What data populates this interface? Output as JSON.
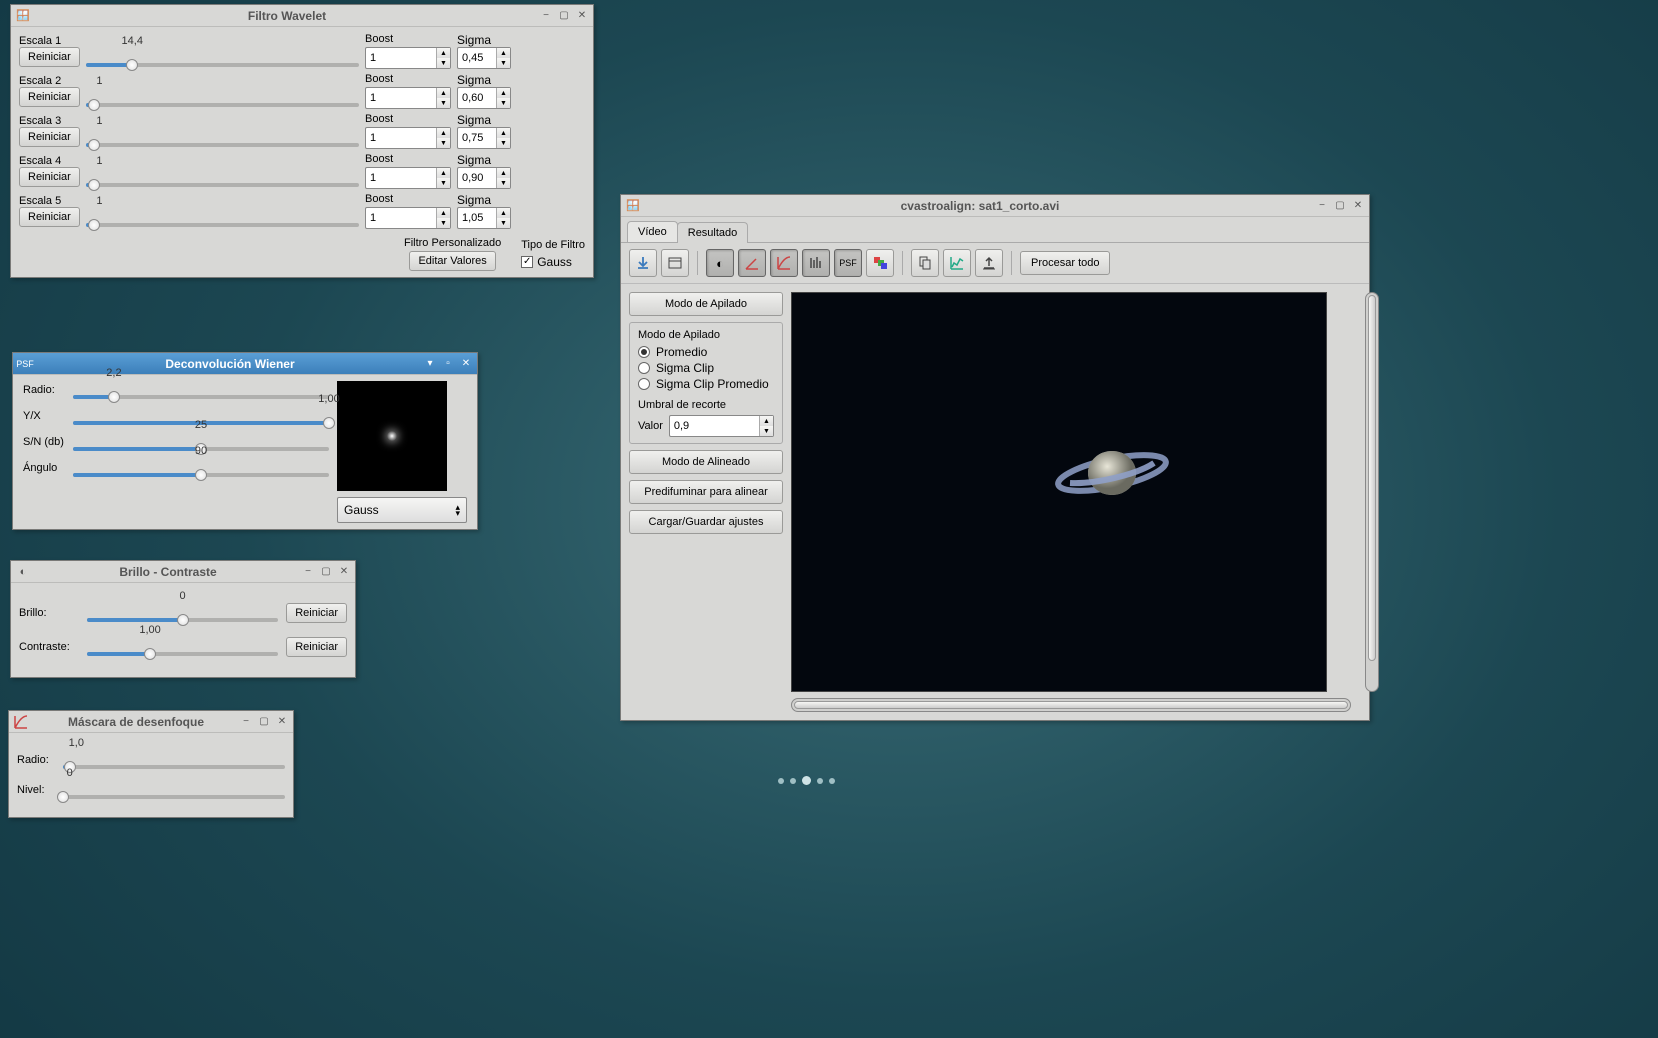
{
  "desktop": {
    "dots": 5
  },
  "wavelet": {
    "title": "Filtro Wavelet",
    "reset_label": "Reiniciar",
    "boost_label": "Boost",
    "sigma_label": "Sigma",
    "scales": [
      {
        "label": "Escala 1",
        "value": "14,4",
        "pct": 17,
        "boost": "1",
        "sigma": "0,45"
      },
      {
        "label": "Escala 2",
        "value": "1",
        "pct": 3,
        "boost": "1",
        "sigma": "0,60"
      },
      {
        "label": "Escala 3",
        "value": "1",
        "pct": 3,
        "boost": "1",
        "sigma": "0,75"
      },
      {
        "label": "Escala 4",
        "value": "1",
        "pct": 3,
        "boost": "1",
        "sigma": "0,90"
      },
      {
        "label": "Escala 5",
        "value": "1",
        "pct": 3,
        "boost": "1",
        "sigma": "1,05"
      }
    ],
    "custom_filter_label": "Filtro Personalizado",
    "edit_values_label": "Editar Valores",
    "filter_type_label": "Tipo de Filtro",
    "gauss_label": "Gauss",
    "gauss_checked": true
  },
  "wiener": {
    "title": "Deconvolución Wiener",
    "tag": "PSF",
    "radius_label": "Radio:",
    "radius_value": "2,2",
    "radius_pct": 16,
    "yx_label": "Y/X",
    "yx_value": "1,00",
    "yx_pct": 100,
    "sn_label": "S/N (db)",
    "sn_value": "25",
    "sn_pct": 50,
    "angle_label": "Ángulo",
    "angle_value": "90",
    "angle_pct": 50,
    "combo_value": "Gauss"
  },
  "brightcon": {
    "title": "Brillo - Contraste",
    "brightness_label": "Brillo:",
    "brightness_value": "0",
    "brightness_pct": 50,
    "contrast_label": "Contraste:",
    "contrast_value": "1,00",
    "contrast_pct": 33,
    "reset_label": "Reiniciar"
  },
  "unsharp": {
    "title": "Máscara de desenfoque",
    "radius_label": "Radio:",
    "radius_value": "1,0",
    "radius_pct": 3,
    "level_label": "Nivel:",
    "level_value": "0",
    "level_pct": 0
  },
  "main": {
    "title": "cvastroalign: sat1_corto.avi",
    "tabs": {
      "video": "Vídeo",
      "result": "Resultado",
      "active": "result"
    },
    "process_all_label": "Procesar todo",
    "side": {
      "stack_mode_btn": "Modo de Apilado",
      "stack_mode_title": "Modo de Apilado",
      "opt_average": "Promedio",
      "opt_sigma": "Sigma Clip",
      "opt_sigma_avg": "Sigma Clip Promedio",
      "selected": "average",
      "threshold_title": "Umbral de recorte",
      "value_label": "Valor",
      "threshold_value": "0,9",
      "align_mode_btn": "Modo de Alineado",
      "preblur_btn": "Predifuminar para alinear",
      "loadsave_btn": "Cargar/Guardar ajustes"
    }
  }
}
